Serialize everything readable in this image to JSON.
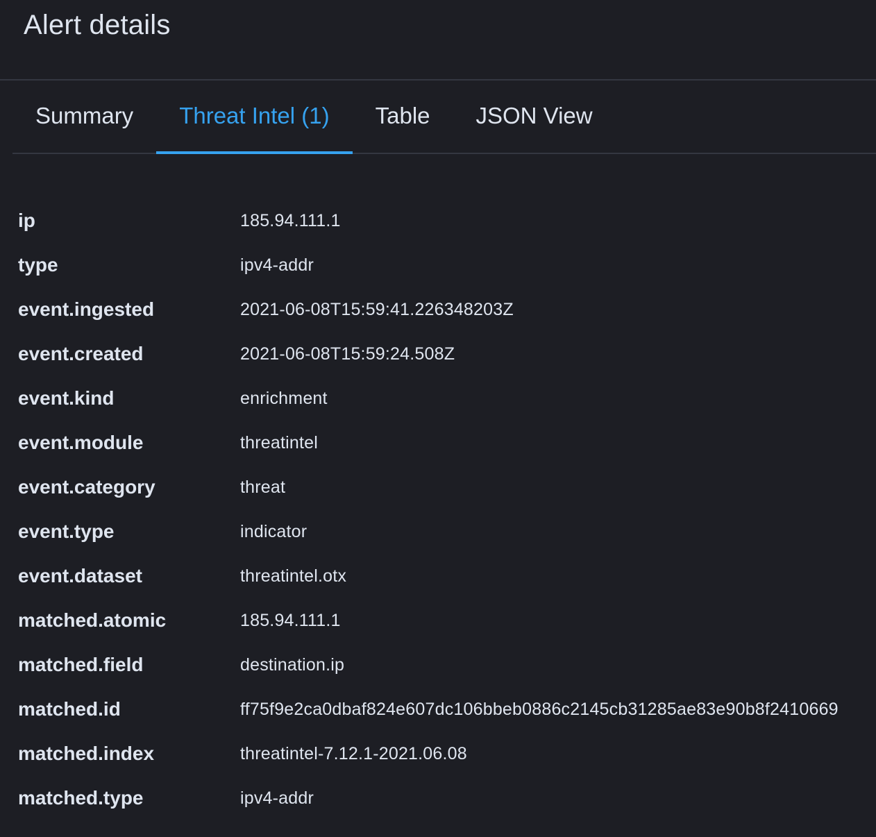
{
  "header": {
    "title": "Alert details"
  },
  "tabs": [
    {
      "label": "Summary",
      "active": false
    },
    {
      "label": "Threat Intel (1)",
      "active": true
    },
    {
      "label": "Table",
      "active": false
    },
    {
      "label": "JSON View",
      "active": false
    }
  ],
  "colors": {
    "background": "#1d1e24",
    "accent": "#36a2ef",
    "text": "#dfe5ef",
    "border": "#343741"
  },
  "fields": [
    {
      "name": "ip",
      "value": "185.94.111.1"
    },
    {
      "name": "type",
      "value": "ipv4-addr"
    },
    {
      "name": "event.ingested",
      "value": "2021-06-08T15:59:41.226348203Z"
    },
    {
      "name": "event.created",
      "value": "2021-06-08T15:59:24.508Z"
    },
    {
      "name": "event.kind",
      "value": "enrichment"
    },
    {
      "name": "event.module",
      "value": "threatintel"
    },
    {
      "name": "event.category",
      "value": "threat"
    },
    {
      "name": "event.type",
      "value": "indicator"
    },
    {
      "name": "event.dataset",
      "value": "threatintel.otx"
    },
    {
      "name": "matched.atomic",
      "value": "185.94.111.1"
    },
    {
      "name": "matched.field",
      "value": "destination.ip"
    },
    {
      "name": "matched.id",
      "value": "ff75f9e2ca0dbaf824e607dc106bbeb0886c2145cb31285ae83e90b8f2410669"
    },
    {
      "name": "matched.index",
      "value": "threatintel-7.12.1-2021.06.08"
    },
    {
      "name": "matched.type",
      "value": "ipv4-addr"
    }
  ]
}
